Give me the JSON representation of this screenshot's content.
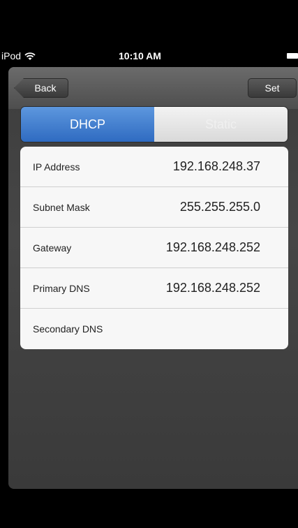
{
  "status_bar": {
    "carrier": "iPod",
    "time": "10:10 AM"
  },
  "nav": {
    "back_label": "Back",
    "set_label": "Set"
  },
  "mode": {
    "options": [
      "DHCP",
      "Static"
    ],
    "selected": "DHCP"
  },
  "network": {
    "rows": [
      {
        "label": "IP Address",
        "value": "192.168.248.37"
      },
      {
        "label": "Subnet Mask",
        "value": "255.255.255.0"
      },
      {
        "label": "Gateway",
        "value": "192.168.248.252"
      },
      {
        "label": "Primary DNS",
        "value": "192.168.248.252"
      },
      {
        "label": "Secondary DNS",
        "value": ""
      }
    ]
  }
}
